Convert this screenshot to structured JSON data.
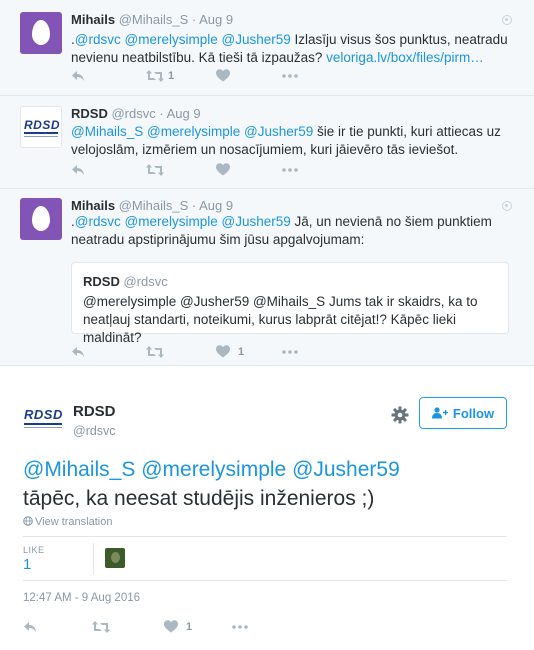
{
  "thread": [
    {
      "name": "Mihails",
      "handle": "@Mihails_S",
      "sep": " · ",
      "time": "Aug 9",
      "avatar": "egg-avatar",
      "text_parts": [
        {
          "t": ".",
          "k": "plain"
        },
        {
          "t": "@rdsvc",
          "k": "mention"
        },
        {
          "t": " ",
          "k": "plain"
        },
        {
          "t": "@merelysimple",
          "k": "mention"
        },
        {
          "t": " ",
          "k": "plain"
        },
        {
          "t": "@Jusher59",
          "k": "mention"
        },
        {
          "t": " Izlasīju visus šos punktus, neatradu nevienu neatbilstību. Kā tieši tā izpaužas? ",
          "k": "plain"
        },
        {
          "t": "veloriga.lv/box/files/pirm…",
          "k": "link"
        }
      ],
      "retweets": "1",
      "likes": ""
    },
    {
      "name": "RDSD",
      "handle": "@rdsvc",
      "sep": " · ",
      "time": "Aug 9",
      "avatar": "rdsd-logo",
      "text_parts": [
        {
          "t": "@Mihails_S",
          "k": "mention"
        },
        {
          "t": " ",
          "k": "plain"
        },
        {
          "t": "@merelysimple",
          "k": "mention"
        },
        {
          "t": " ",
          "k": "plain"
        },
        {
          "t": "@Jusher59",
          "k": "mention"
        },
        {
          "t": " šie ir tie punkti, kuri attiecas uz velojoslām, izmēriem un nosacījumiem, kuri jāievēro tās ieviešot.",
          "k": "plain"
        }
      ],
      "retweets": "",
      "likes": ""
    },
    {
      "name": "Mihails",
      "handle": "@Mihails_S",
      "sep": " · ",
      "time": "Aug 9",
      "avatar": "egg-avatar",
      "text_parts": [
        {
          "t": ".",
          "k": "plain"
        },
        {
          "t": "@rdsvc",
          "k": "mention"
        },
        {
          "t": " ",
          "k": "plain"
        },
        {
          "t": "@merelysimple",
          "k": "mention"
        },
        {
          "t": " ",
          "k": "plain"
        },
        {
          "t": "@Jusher59",
          "k": "mention"
        },
        {
          "t": " Jā, un nevienā no šiem punktiem neatradu apstiprinājumu šim jūsu apgalvojumam:",
          "k": "plain"
        }
      ],
      "retweets": "",
      "likes": "1"
    }
  ],
  "quote": {
    "name": "RDSD",
    "handle": "@rdsvc",
    "text": "@merelysimple @Jusher59 @Mihails_S Jums tak ir skaidrs, ka to neatļauj standarti, noteikumi, kurus labprāt citējat!? Kāpēc lieki maldināt?"
  },
  "main_tweet": {
    "name": "RDSD",
    "handle": "@rdsvc",
    "logo_text": "RDSD",
    "follow_label": "Follow",
    "mentions": [
      "@Mihails_S",
      "@merelysimple",
      "@Jusher59"
    ],
    "text": "tāpēc, ka neesat studējis inženieros ;)",
    "translate_label": "View translation",
    "like_label": "LIKE",
    "like_count": "1",
    "timestamp": "12:47 AM - 9 Aug 2016",
    "likes": "1"
  },
  "colors": {
    "accent": "#1b95e0",
    "muted": "#8899a6",
    "thread_bg": "#f5f8fa",
    "egg_purple": "#8254b5",
    "rdsd_blue": "#1b3d8f"
  },
  "icons": [
    "reply-icon",
    "retweet-icon",
    "like-icon",
    "more-icon",
    "caret-icon",
    "gear-icon",
    "follow-person-icon",
    "globe-icon"
  ]
}
